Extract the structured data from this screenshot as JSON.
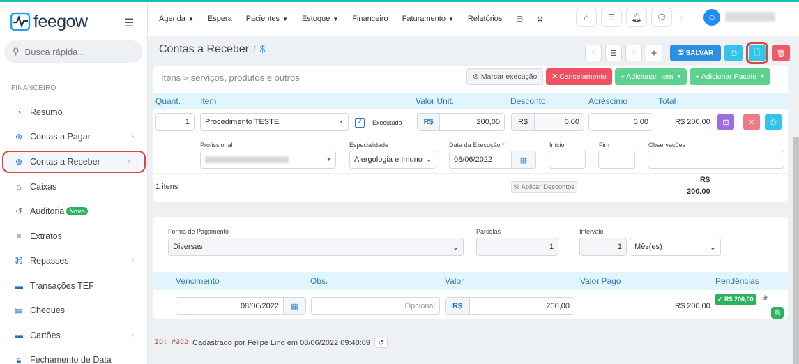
{
  "app": {
    "logo_text": "feegow"
  },
  "nav": {
    "links": [
      {
        "label": "Agenda",
        "dropdown": true
      },
      {
        "label": "Espera",
        "dropdown": false
      },
      {
        "label": "Pacientes",
        "dropdown": true
      },
      {
        "label": "Estoque",
        "dropdown": true
      },
      {
        "label": "Financeiro",
        "dropdown": false
      },
      {
        "label": "Faturamento",
        "dropdown": true
      },
      {
        "label": "Relatórios",
        "dropdown": false
      }
    ]
  },
  "search": {
    "placeholder": "Busca rápida..."
  },
  "sidebar": {
    "section": "FINANCEIRO",
    "items": [
      {
        "label": "Resumo",
        "icon": "pie-icon",
        "chevron": false
      },
      {
        "label": "Contas a Pagar",
        "icon": "arrow-up-circle-icon",
        "chevron": true
      },
      {
        "label": "Contas a Receber",
        "icon": "arrow-down-circle-icon",
        "chevron": true,
        "active": true
      },
      {
        "label": "Caixas",
        "icon": "inbox-icon",
        "chevron": false
      },
      {
        "label": "Auditoria",
        "icon": "history-icon",
        "chevron": false,
        "badge": "Novo"
      },
      {
        "label": "Extratos",
        "icon": "list-icon",
        "chevron": false
      },
      {
        "label": "Repasses",
        "icon": "handshake-icon",
        "chevron": true
      },
      {
        "label": "Transações TEF",
        "icon": "card-icon",
        "chevron": false
      },
      {
        "label": "Cheques",
        "icon": "cheque-icon",
        "chevron": false
      },
      {
        "label": "Cartões",
        "icon": "credit-card-icon",
        "chevron": true
      },
      {
        "label": "Fechamento de Data",
        "icon": "lock-icon",
        "chevron": false
      }
    ]
  },
  "header": {
    "title": "Contas a Receber",
    "symbol": "$",
    "save_label": "SALVAR"
  },
  "items_card": {
    "subtitle": "Itens » serviços, produtos e outros",
    "mark_label": "Marcar execução",
    "cancel_label": "Cancelamento",
    "add_item_label": "+ Adicionar Item",
    "add_package_label": "+ Adicionar Pacote",
    "columns": [
      "Quant.",
      "Item",
      "Valor Unit.",
      "Desconto",
      "Acréscimo",
      "Total"
    ],
    "row": {
      "quantity": "1",
      "item": "Procedimento TESTE",
      "executed_label": "Executado",
      "currency": "R$",
      "unit_value": "200,00",
      "discount": "0,00",
      "increase": "0,00",
      "total": "R$ 200,00"
    },
    "detail": {
      "professional_label": "Profissional",
      "specialty_label": "Especialidade",
      "specialty_value": "Alergologia e Imuno",
      "exec_date_label": "Data da Execução",
      "exec_date_value": "08/06/2022",
      "start_label": "Início",
      "end_label": "Fim",
      "notes_label": "Observações"
    },
    "count": "1 itens",
    "apply_discounts": "Aplicar Descontos",
    "sum_currency": "R$",
    "sum_value": "200,00"
  },
  "payment_card": {
    "method_label": "Forma de Pagamento",
    "method_value": "Diversas",
    "installments_label": "Parcelas",
    "installments_value": "1",
    "interval_label": "Intervalo",
    "interval_value": "1",
    "interval_unit": "Mês(es)",
    "columns": [
      "Vencimento",
      "Obs.",
      "Valor",
      "Valor Pago",
      "Pendências"
    ],
    "row": {
      "due_date": "08/06/2022",
      "obs_placeholder": "Opcional",
      "currency": "R$",
      "value": "200,00",
      "paid": "R$ 200,00",
      "pending_badge": "✓ R$ 200,00"
    }
  },
  "footer": {
    "id": "ID: #392",
    "text": "Cadastrado por Felipe Lino em 08/06/2022 09:48:09"
  },
  "colors": {
    "accent": "#2c8fe3",
    "teal": "#19c1b5",
    "danger": "#ef5160",
    "success": "#2ab25d",
    "highlight": "#d64a3b"
  }
}
